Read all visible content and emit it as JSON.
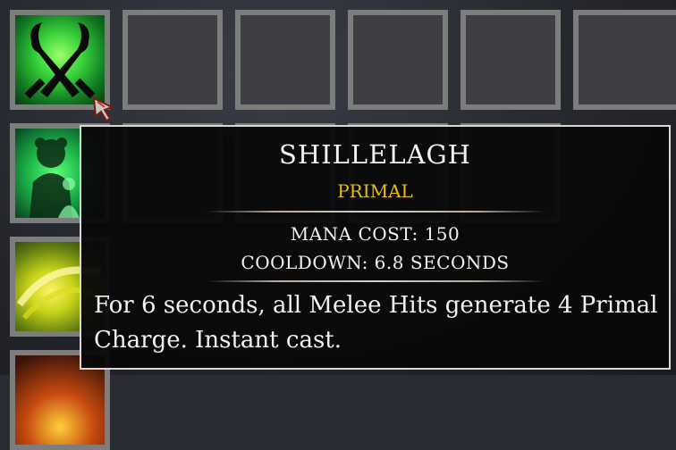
{
  "action_bar": {
    "slots": [
      {
        "icon": "shillelagh-crossed-clubs-icon",
        "empty": false
      },
      {
        "icon": null,
        "empty": true
      },
      {
        "icon": null,
        "empty": true
      },
      {
        "icon": null,
        "empty": true
      },
      {
        "icon": null,
        "empty": true
      },
      {
        "icon": null,
        "empty": true
      }
    ],
    "side_slots": [
      {
        "icon": "bear-spirit-icon"
      },
      {
        "icon": "yellow-swirl-icon"
      },
      {
        "icon": "fire-icon"
      }
    ]
  },
  "tooltip": {
    "title": "SHILLELAGH",
    "subtitle": "PRIMAL",
    "mana_cost": "MANA COST: 150",
    "cooldown": "COOLDOWN: 6.8 SECONDS",
    "description": "For 6 seconds, all Melee Hits generate 4 Primal Charge. Instant cast."
  },
  "colors": {
    "subtitle": "#e8c200",
    "tooltip_border": "#d8d8d8",
    "slot_border": "#7d7d7d"
  }
}
